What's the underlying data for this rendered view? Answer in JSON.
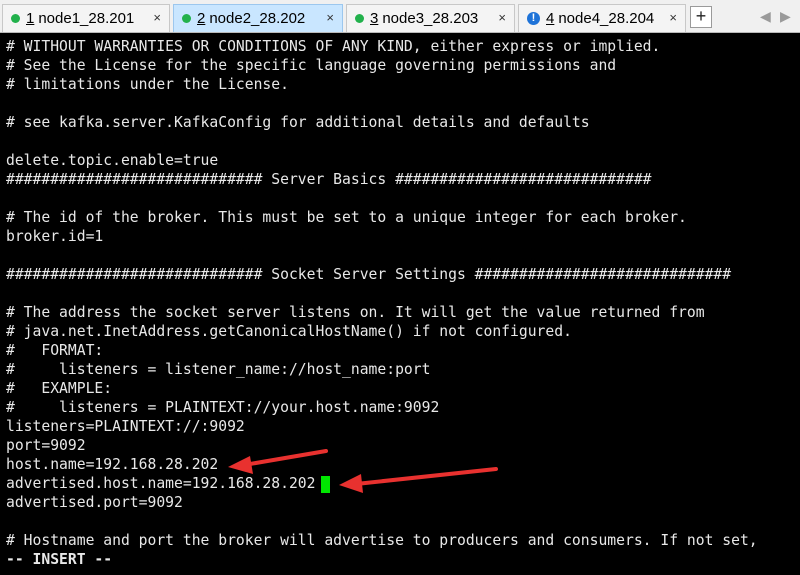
{
  "tabs": [
    {
      "number": "1",
      "label": "node1_28.201",
      "status": "connected",
      "active": false
    },
    {
      "number": "2",
      "label": "node2_28.202",
      "status": "connected",
      "active": true
    },
    {
      "number": "3",
      "label": "node3_28.203",
      "status": "connected",
      "active": false
    },
    {
      "number": "4",
      "label": "node4_28.204",
      "status": "disconnected",
      "active": false
    }
  ],
  "tab_close_glyph": "×",
  "add_tab_glyph": "+",
  "nav": {
    "prev": "◀",
    "next": "▶"
  },
  "terminal": {
    "lines": [
      "# WITHOUT WARRANTIES OR CONDITIONS OF ANY KIND, either express or implied.",
      "# See the License for the specific language governing permissions and",
      "# limitations under the License.",
      "",
      "# see kafka.server.KafkaConfig for additional details and defaults",
      "",
      "delete.topic.enable=true",
      "############################# Server Basics #############################",
      "",
      "# The id of the broker. This must be set to a unique integer for each broker.",
      "broker.id=1",
      "",
      "############################# Socket Server Settings #############################",
      "",
      "# The address the socket server listens on. It will get the value returned from",
      "# java.net.InetAddress.getCanonicalHostName() if not configured.",
      "#   FORMAT:",
      "#     listeners = listener_name://host_name:port",
      "#   EXAMPLE:",
      "#     listeners = PLAINTEXT://your.host.name:9092",
      "listeners=PLAINTEXT://:9092",
      "port=9092",
      "host.name=192.168.28.202",
      "advertised.host.name=192.168.28.202",
      "advertised.port=9092",
      "",
      "# Hostname and port the broker will advertise to producers and consumers. If not set,"
    ],
    "status_line": "-- INSERT --"
  },
  "colors": {
    "background": "#000000",
    "text": "#e8e8e8",
    "cursor": "#00e600",
    "arrow": "#e8312f",
    "active_tab": "#c9e6ff",
    "connected_dot": "#22b14c",
    "disconnected_icon": "#1e73d8"
  }
}
